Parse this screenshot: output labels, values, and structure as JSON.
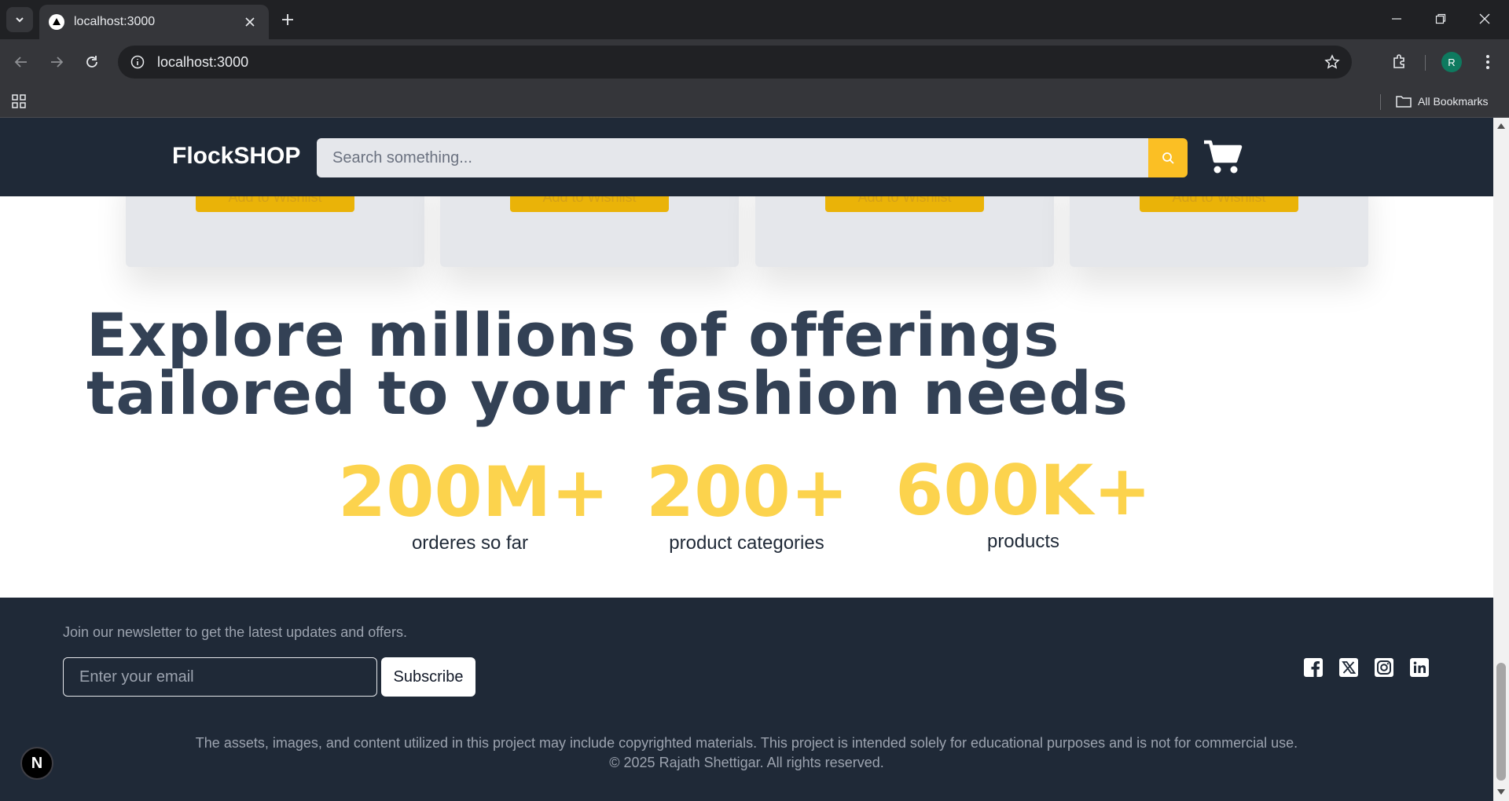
{
  "browser": {
    "tab_title": "localhost:3000",
    "url": "localhost:3000",
    "avatar_letter": "R",
    "bookmarks_label": "All Bookmarks"
  },
  "header": {
    "logo": "FlockSHOP",
    "search_placeholder": "Search something..."
  },
  "cards": {
    "button_label": "Add to Wishlist"
  },
  "hero": {
    "title": "Explore millions of offerings tailored to your fashion needs",
    "stats": [
      {
        "value": "200M+",
        "label": "orderes so far"
      },
      {
        "value": "200+",
        "label": "product categories"
      },
      {
        "value": "600K+",
        "label": "products"
      }
    ]
  },
  "footer": {
    "newsletter_text": "Join our newsletter to get the latest updates and offers.",
    "email_placeholder": "Enter your email",
    "subscribe_label": "Subscribe",
    "disclaimer": "The assets, images, and content utilized in this project may include copyrighted materials. This project is intended solely for educational purposes and is not for commercial use.",
    "copyright": "© 2025 Rajath Shettigar. All rights reserved.",
    "social": [
      "facebook-icon",
      "x-icon",
      "instagram-icon",
      "linkedin-icon"
    ]
  },
  "next_badge": "N",
  "colors": {
    "header_bg": "#1f2937",
    "accent": "#fbbf24",
    "stat_color": "#fcd34d",
    "hero_text": "#334155"
  }
}
